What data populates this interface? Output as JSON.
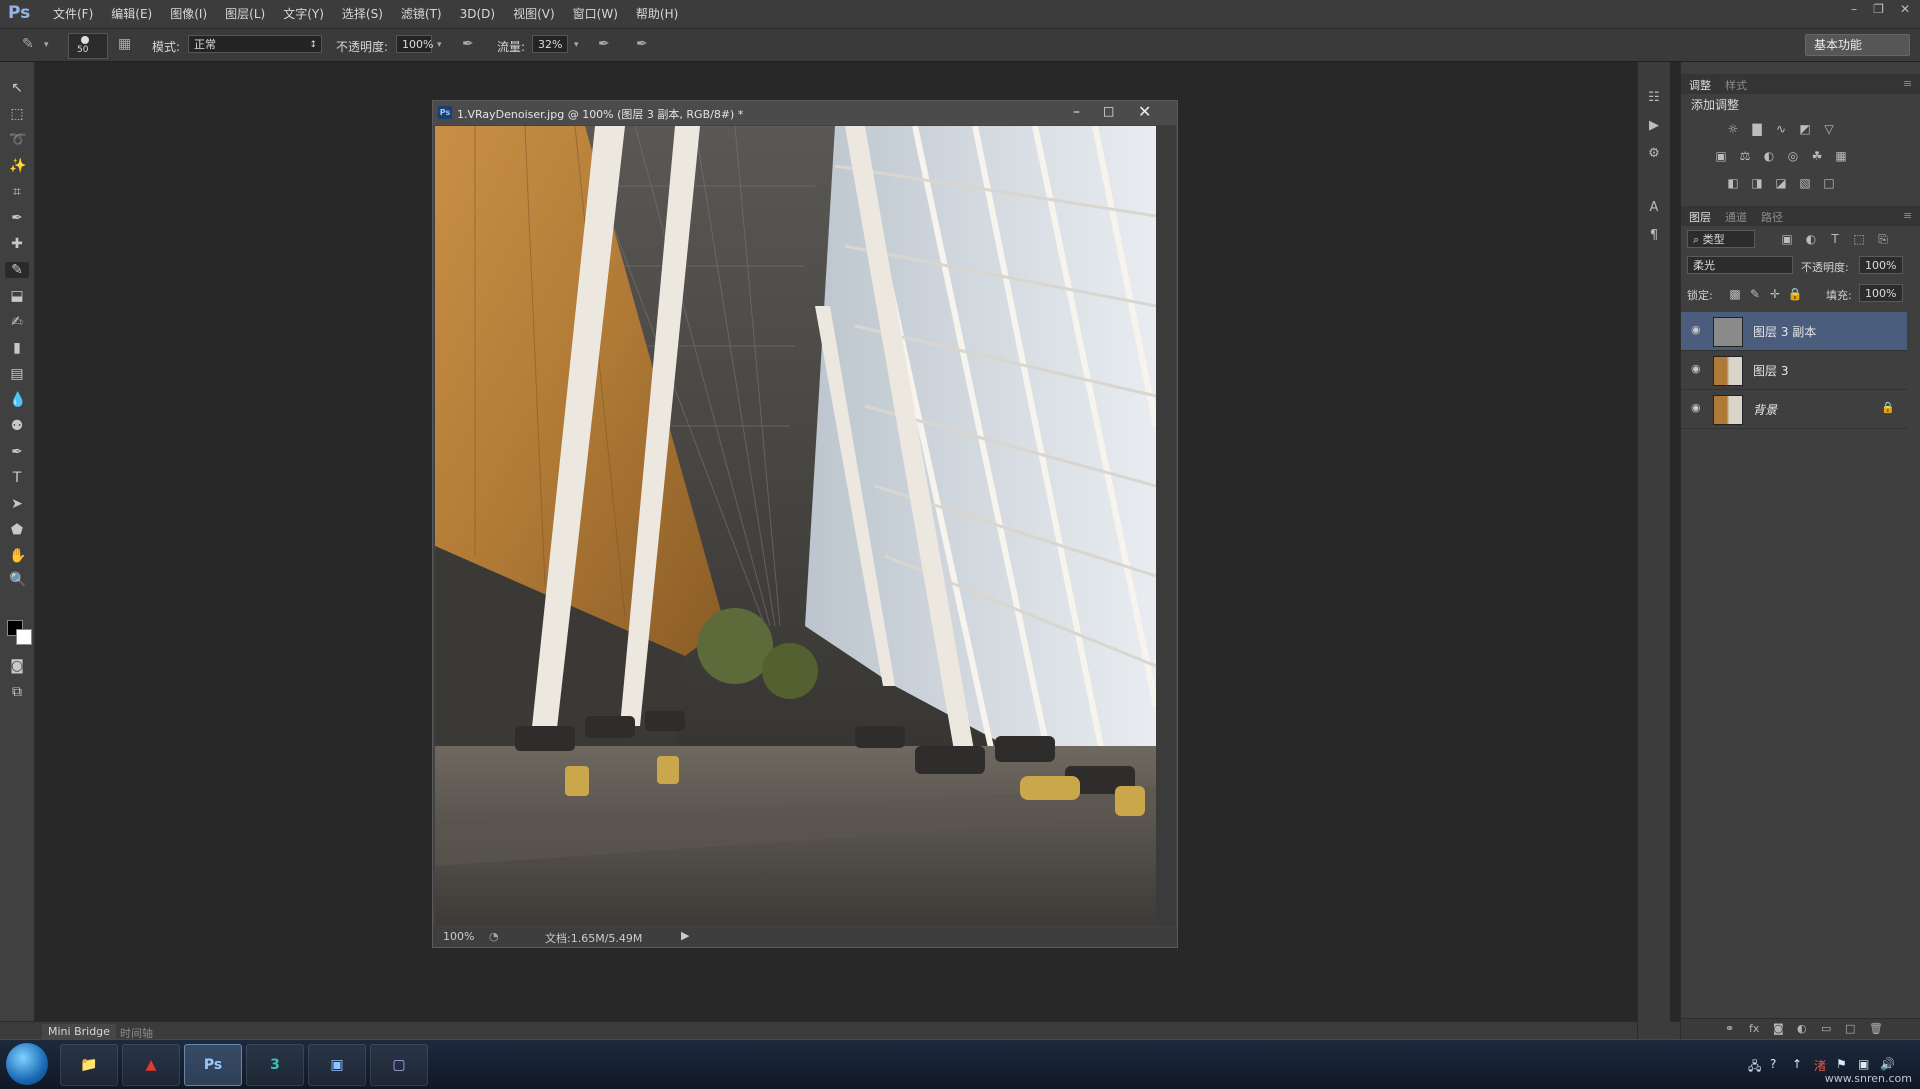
{
  "app": {
    "logo": "Ps"
  },
  "menu": [
    "文件(F)",
    "编辑(E)",
    "图像(I)",
    "图层(L)",
    "文字(Y)",
    "选择(S)",
    "滤镜(T)",
    "3D(D)",
    "视图(V)",
    "窗口(W)",
    "帮助(H)"
  ],
  "options": {
    "brush_size": "50",
    "mode_label": "模式:",
    "mode_value": "正常",
    "opacity_label": "不透明度:",
    "opacity_value": "100%",
    "flow_label": "流量:",
    "flow_value": "32%",
    "workspace": "基本功能"
  },
  "document": {
    "title": "1.VRayDenoiser.jpg @ 100% (图层 3 副本, RGB/8#) *",
    "ps_badge": "Ps",
    "zoom": "100%",
    "doc_size": "文档:1.65M/5.49M"
  },
  "bottom_tabs": {
    "mini_bridge": "Mini Bridge",
    "timeline": "时间轴"
  },
  "adjust_panel": {
    "tabs": [
      "调整",
      "样式"
    ],
    "title": "添加调整"
  },
  "layers_panel": {
    "tabs": [
      "图层",
      "通道",
      "路径"
    ],
    "filter_value": "类型",
    "blend_mode": "柔光",
    "opacity_label": "不透明度:",
    "opacity_value": "100%",
    "lock_label": "锁定:",
    "fill_label": "填充:",
    "fill_value": "100%",
    "layers": [
      {
        "name": "图层 3 副本",
        "selected": true
      },
      {
        "name": "图层 3",
        "selected": false
      },
      {
        "name": "背景",
        "selected": false,
        "locked": true
      }
    ]
  },
  "taskbar": {
    "apps": [
      "folder",
      "Acrobat",
      "Ps",
      "3ds Max",
      "window",
      "Screen capture"
    ],
    "watermark": "www.snren.com"
  }
}
